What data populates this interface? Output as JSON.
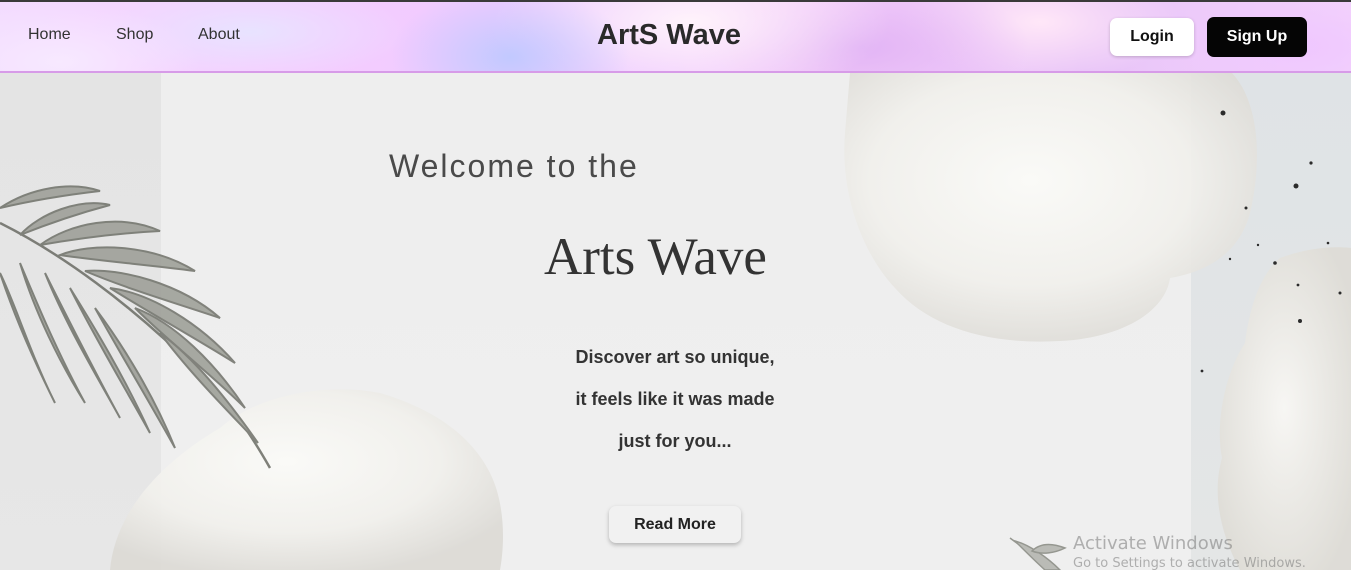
{
  "header": {
    "nav": {
      "home": "Home",
      "shop": "Shop",
      "about": "About"
    },
    "brand": "ArtS Wave",
    "login_label": "Login",
    "signup_label": "Sign Up"
  },
  "hero": {
    "welcome": "Welcome to the",
    "title": "Arts Wave",
    "tagline": [
      "Discover art so unique,",
      "it feels like it was made",
      "just for you..."
    ],
    "read_more_label": "Read More"
  },
  "os_watermark": {
    "line1": "Activate Windows",
    "line2": "Go to Settings to activate Windows."
  },
  "colors": {
    "signup_bg": "#050505",
    "header_accent": "#d79be8",
    "text": "#333333"
  }
}
